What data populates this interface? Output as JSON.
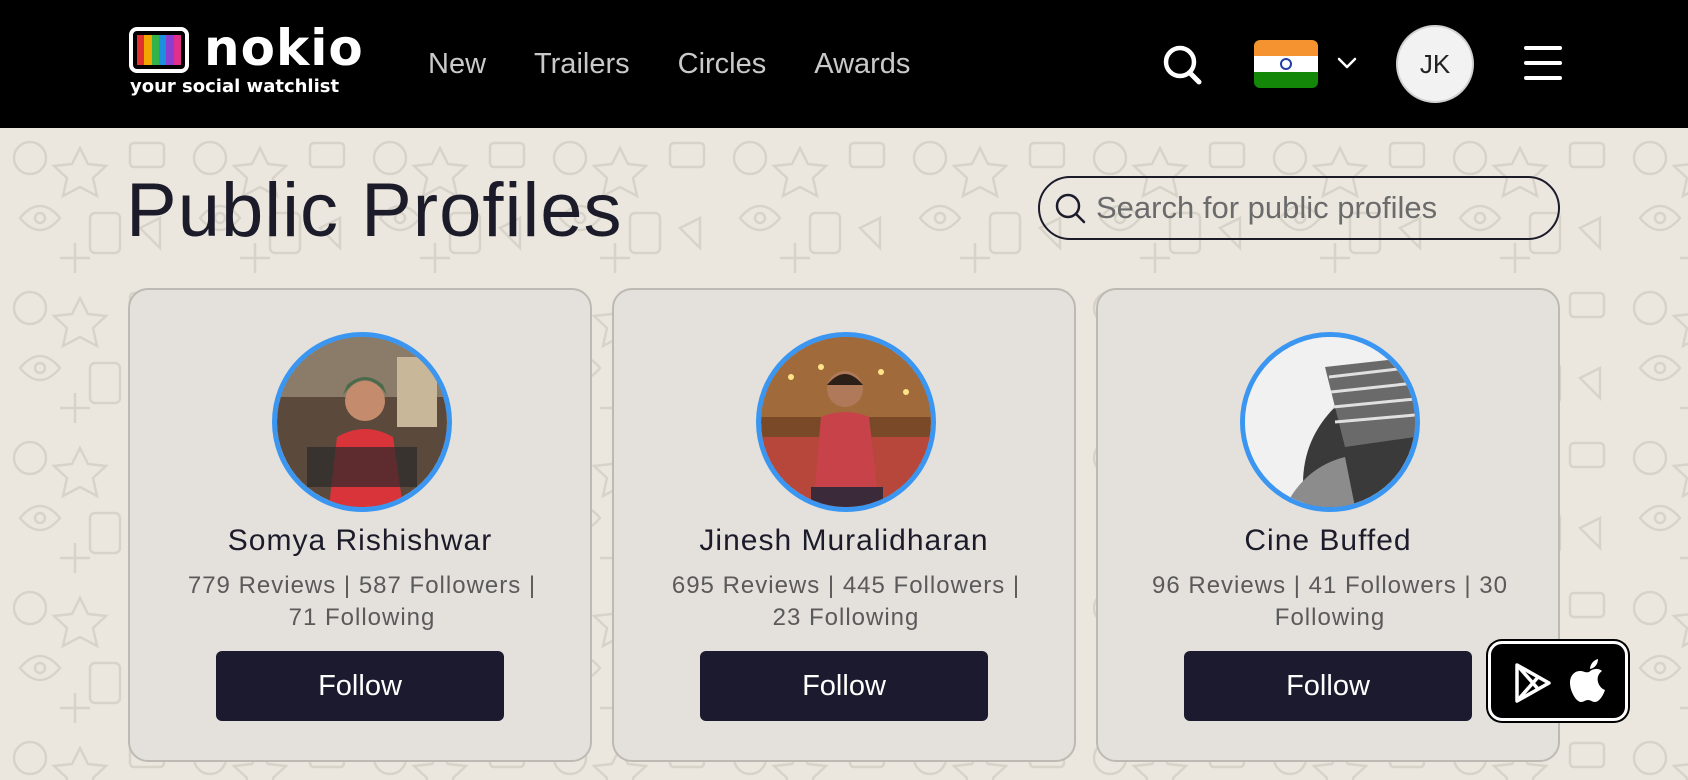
{
  "colors": {
    "header_bg": "#000000",
    "page_bg": "#ebe7df",
    "card_bg": "#e4e1dc",
    "accent_ring": "#3b96f2",
    "button_bg": "#1c1a2e",
    "title_text": "#1c1b2a"
  },
  "header": {
    "logo": {
      "wordmark": "nokio",
      "tagline": "your social watchlist"
    },
    "nav": [
      {
        "label": "New"
      },
      {
        "label": "Trailers"
      },
      {
        "label": "Circles"
      },
      {
        "label": "Awards"
      }
    ],
    "icons": {
      "search": "search-icon",
      "flag": "india-flag-icon",
      "chevron": "chevron-down-icon",
      "menu": "hamburger-menu-icon"
    },
    "avatar_initials": "JK"
  },
  "main": {
    "title": "Public Profiles",
    "search": {
      "placeholder": "Search for public profiles",
      "value": ""
    }
  },
  "profiles": [
    {
      "name": "Somya Rishishwar",
      "stats": "779 Reviews | 587 Followers | 71 Following",
      "follow_label": "Follow"
    },
    {
      "name": "Jinesh Muralidharan",
      "stats": "695 Reviews | 445 Followers | 23 Following",
      "follow_label": "Follow"
    },
    {
      "name": "Cine Buffed",
      "stats": "96 Reviews | 41 Followers | 30 Following",
      "follow_label": "Follow"
    }
  ],
  "app_badge": {
    "icons": [
      "google-play-icon",
      "apple-icon"
    ]
  }
}
